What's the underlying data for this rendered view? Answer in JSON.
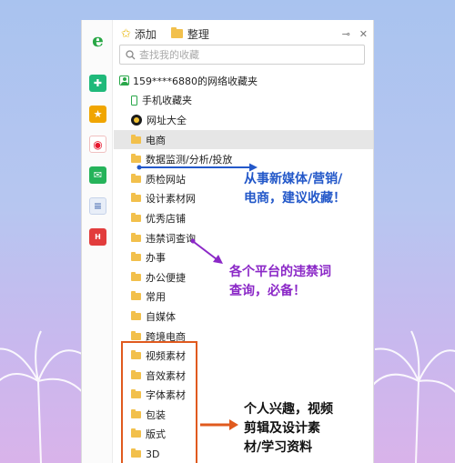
{
  "toolbar": {
    "add_label": "添加",
    "organize_label": "整理",
    "pin_glyph": "⊸",
    "close_glyph": "✕"
  },
  "search": {
    "placeholder": "查找我的收藏"
  },
  "rail_icons": [
    "ie-logo-icon",
    "plus-app-icon",
    "favorites-star-icon",
    "weibo-icon",
    "mail-icon",
    "document-icon",
    "red-app-icon"
  ],
  "tree": {
    "root_label": "159****6880的网络收藏夹",
    "items": [
      {
        "label": "手机收藏夹",
        "icon": "phone-icon"
      },
      {
        "label": "网址大全",
        "icon": "globe-icon"
      },
      {
        "label": "电商",
        "icon": "folder-icon",
        "selected": true
      },
      {
        "label": "数据监测/分析/投放",
        "icon": "folder-icon"
      },
      {
        "label": "质检网站",
        "icon": "folder-icon"
      },
      {
        "label": "设计素材网",
        "icon": "folder-icon"
      },
      {
        "label": "优秀店铺",
        "icon": "folder-icon"
      },
      {
        "label": "违禁词查询",
        "icon": "folder-icon"
      },
      {
        "label": "办事",
        "icon": "folder-icon"
      },
      {
        "label": "办公便捷",
        "icon": "folder-icon"
      },
      {
        "label": "常用",
        "icon": "folder-icon"
      },
      {
        "label": "自媒体",
        "icon": "folder-icon"
      },
      {
        "label": "跨境电商",
        "icon": "folder-icon"
      },
      {
        "label": "视频素材",
        "icon": "folder-icon"
      },
      {
        "label": "音效素材",
        "icon": "folder-icon"
      },
      {
        "label": "字体素材",
        "icon": "folder-icon"
      },
      {
        "label": "包装",
        "icon": "folder-icon"
      },
      {
        "label": "版式",
        "icon": "folder-icon"
      },
      {
        "label": "3D",
        "icon": "folder-icon"
      }
    ]
  },
  "annotations": {
    "ecommerce_note": "从事新媒体/营销/电商，建议收藏！",
    "forbidden_words_note": "各个平台的违禁词查询，必备！",
    "materials_note": "个人兴趣，视频剪辑及设计素材/学习资料"
  },
  "colors": {
    "blue_note": "#2358c9",
    "purple_note": "#8b28c7",
    "orange_box": "#e05a1e",
    "folder": "#f2c04c",
    "green_accent": "#2aa74a"
  }
}
